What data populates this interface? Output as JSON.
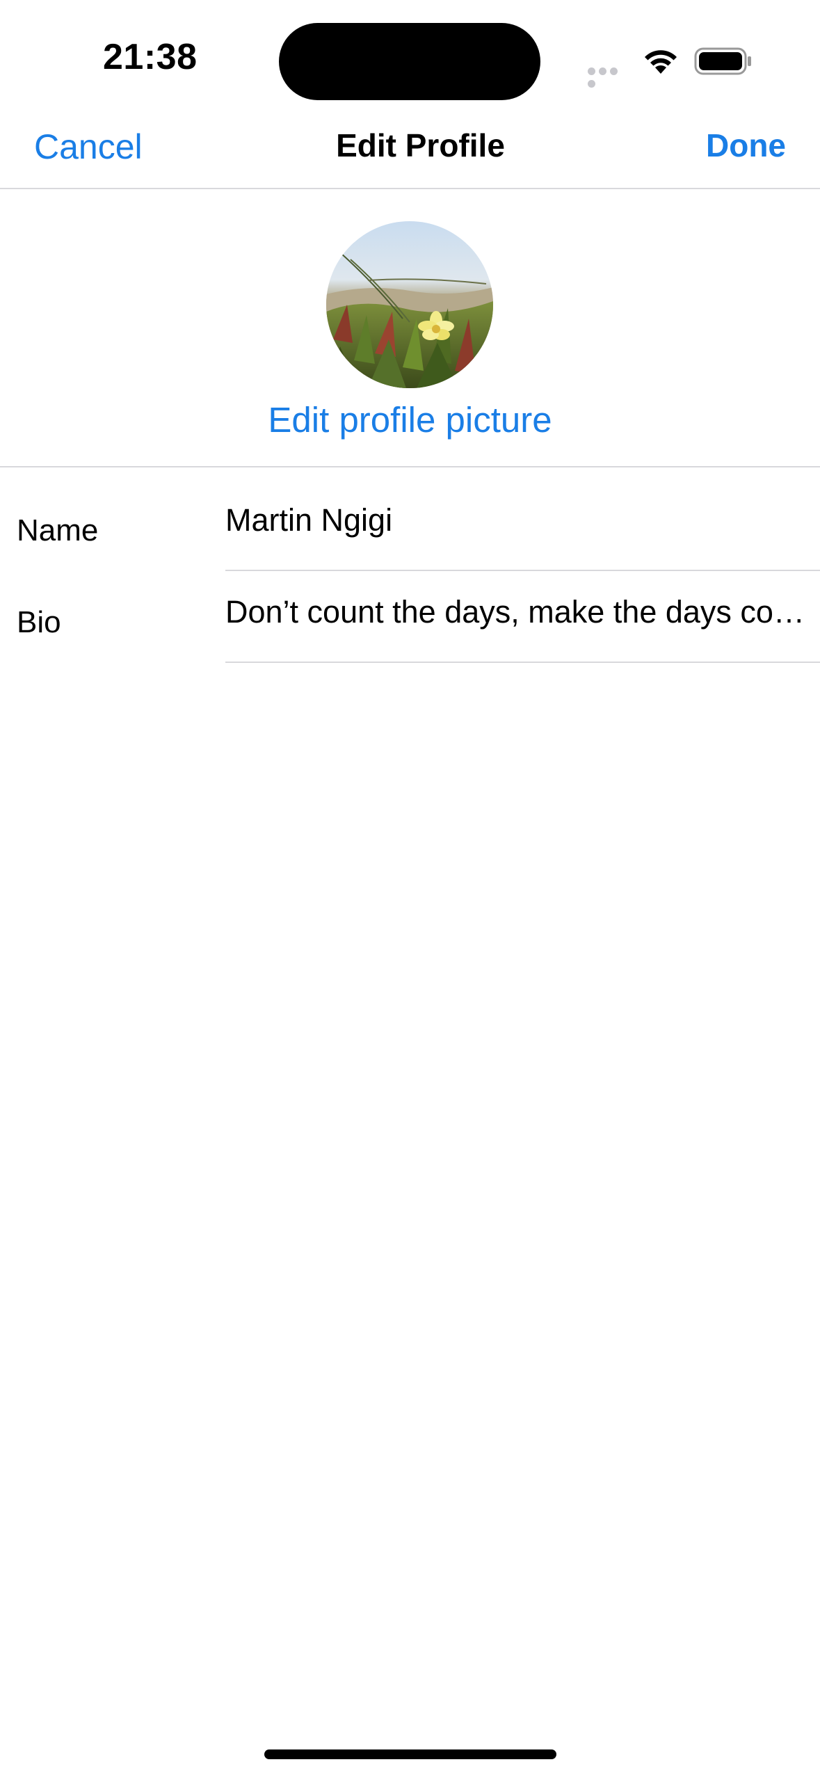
{
  "status_bar": {
    "time": "21:38"
  },
  "nav": {
    "cancel_label": "Cancel",
    "title": "Edit Profile",
    "done_label": "Done"
  },
  "profile": {
    "avatar_icon": "profile-photo",
    "edit_picture_label": "Edit profile picture"
  },
  "form": {
    "name_label": "Name",
    "name_value": "Martin Ngigi",
    "bio_label": "Bio",
    "bio_value": "Don’t count the days, make the days co…"
  },
  "colors": {
    "accent": "#1a7ee6",
    "separator": "#d8d8dc",
    "background": "#ffffff"
  }
}
